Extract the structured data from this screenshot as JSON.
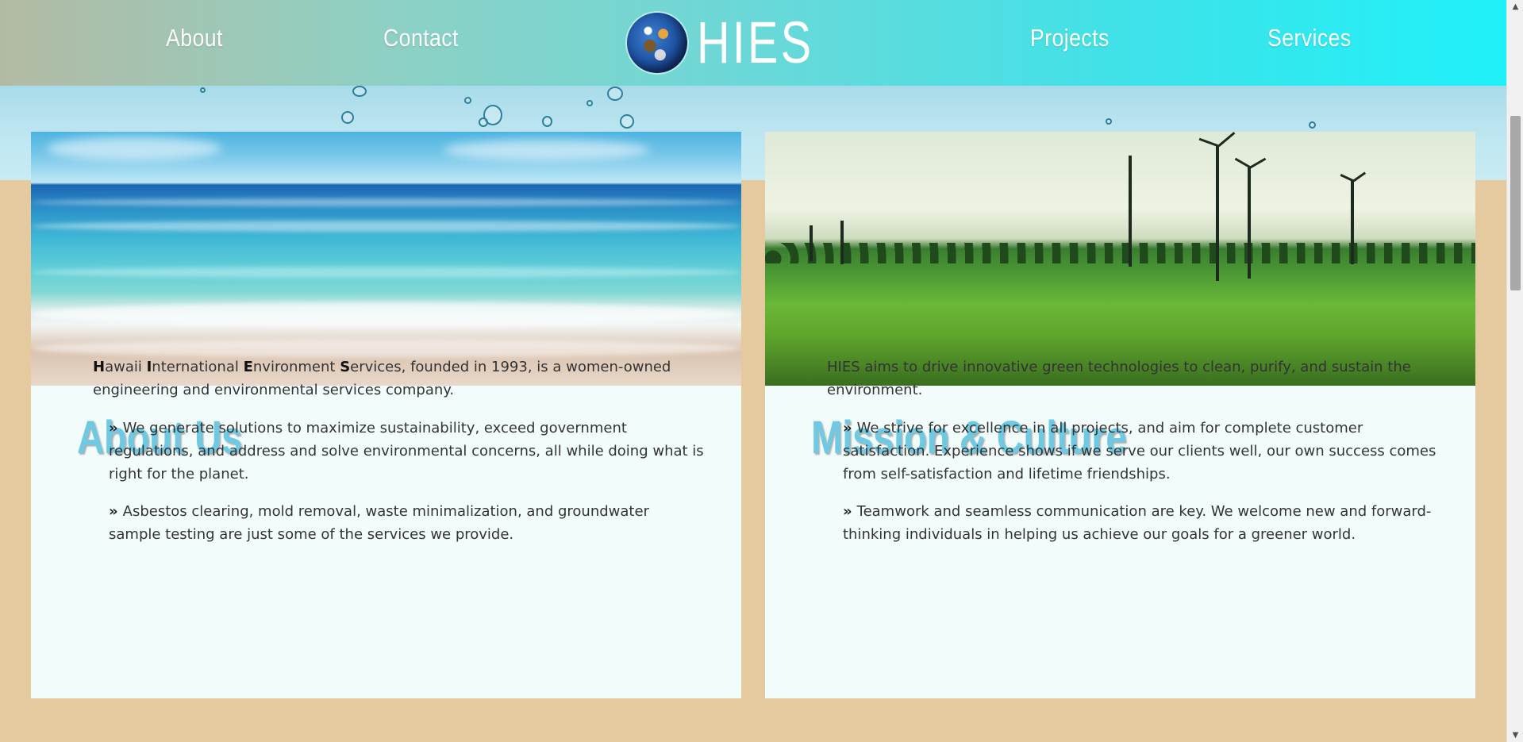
{
  "nav": {
    "links": [
      "About",
      "Contact",
      "Projects",
      "Services"
    ],
    "brand": "HIES",
    "logo_icon": "globe-icon",
    "gradient": [
      "#b3baa3",
      "#1ff1f9"
    ]
  },
  "colors": {
    "page_background": "#e5c99f",
    "card_background": "#f2fcfb",
    "heading": "#6fc9e3",
    "body_text": "#333333"
  },
  "about": {
    "image_alt": "ocean-beach-image",
    "title": "About Us",
    "intro": {
      "h": "H",
      "awaii": "awaii ",
      "i": "I",
      "nternational": "nternational ",
      "e": "E",
      "nvironment": "nvironment ",
      "s": "S",
      "rest": "ervices, founded in 1993, is a women-owned engineering and environmental services company."
    },
    "bullets": [
      "We generate solutions to maximize sustainability, exceed government regulations, and address and solve environmental concerns, all while doing what is right for the planet.",
      "Asbestos clearing, mold removal, waste minimalization, and groundwater sample testing are just some of the services we provide."
    ]
  },
  "mission": {
    "image_alt": "wind-turbines-field-image",
    "title": "Mission & Culture",
    "intro": "HIES aims to drive innovative green technologies to clean, purify, and sustain the environment.",
    "bullets": [
      "We strive for excellence in all projects, and aim for complete customer satisfaction. Experience shows if we serve our clients well, our own success comes from self-satisfaction and lifetime friendships.",
      "Teamwork and seamless communication are key. We welcome new and forward-thinking individuals in helping us achieve our goals for a greener world."
    ]
  },
  "bullet_glyph": "»"
}
